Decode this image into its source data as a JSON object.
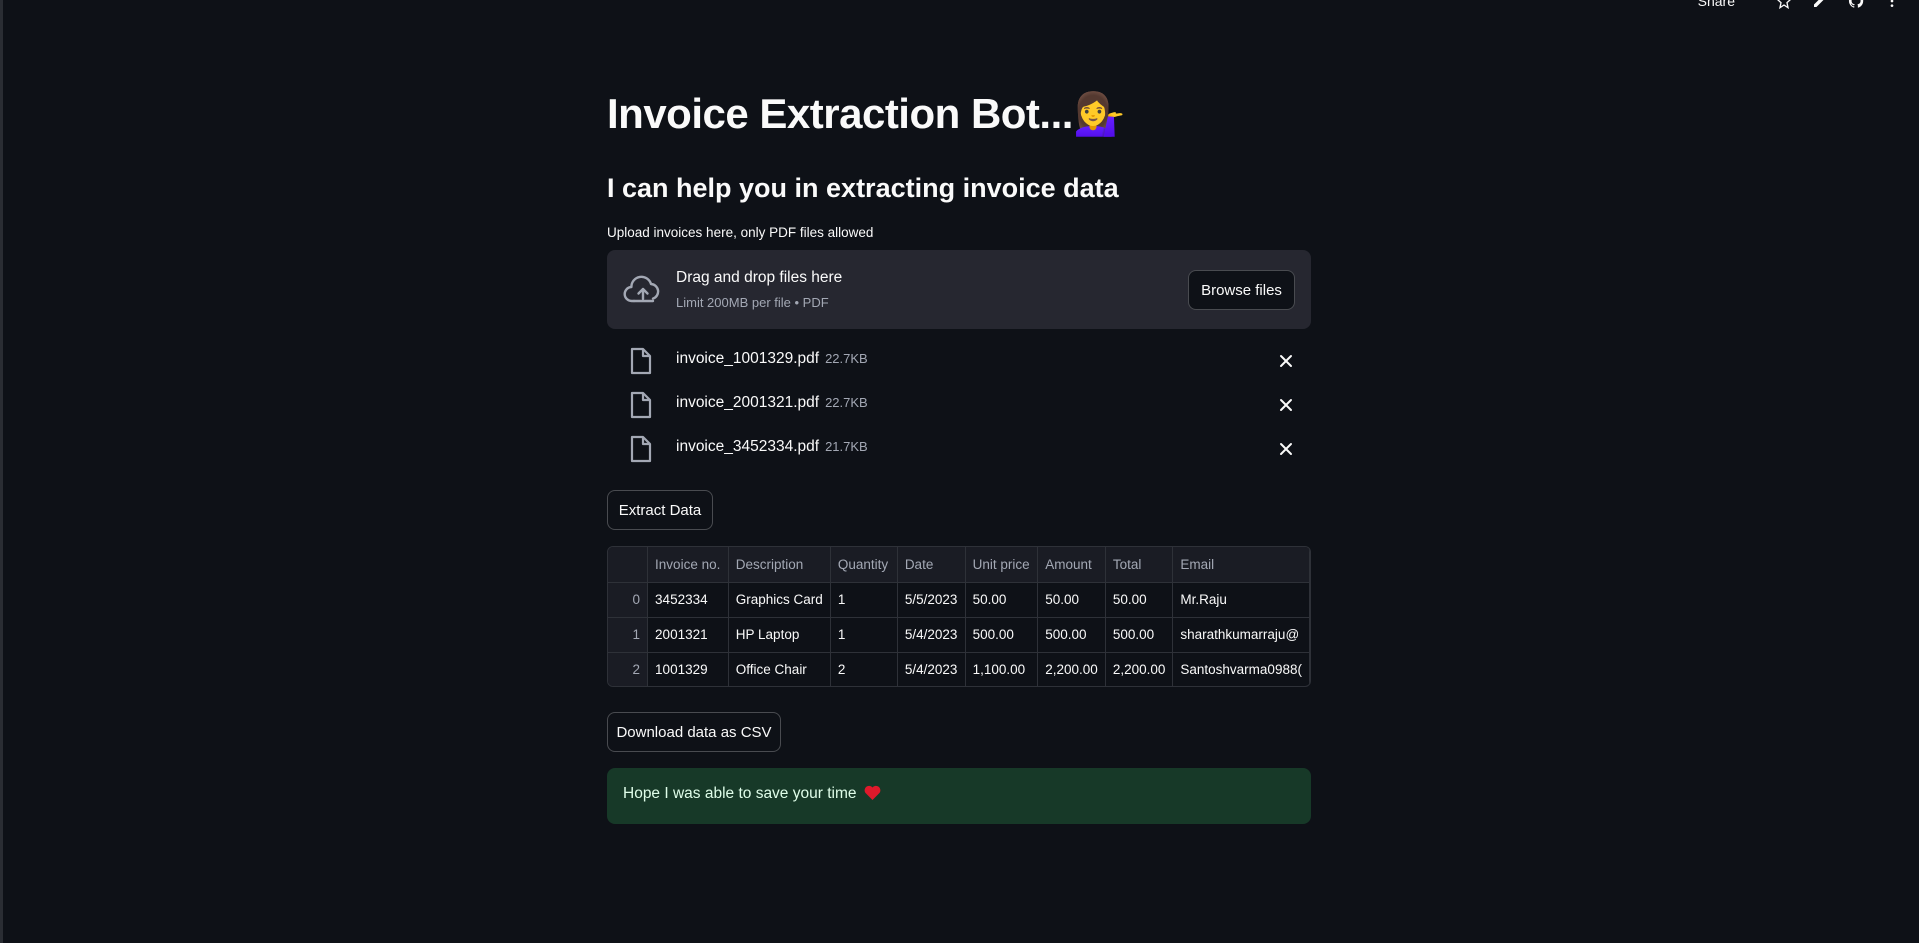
{
  "topbar": {
    "share_label": "Share",
    "icons": [
      "star-icon",
      "pencil-icon",
      "github-icon",
      "more-vertical-icon"
    ]
  },
  "header": {
    "title": "Invoice Extraction Bot...",
    "title_emoji": "💁‍♀️",
    "subtitle": "I can help you in extracting invoice data"
  },
  "uploader": {
    "label": "Upload invoices here, only PDF files allowed",
    "drop_title": "Drag and drop files here",
    "limit_text": "Limit 200MB per file • PDF",
    "browse_label": "Browse files",
    "files": [
      {
        "name": "invoice_1001329.pdf",
        "size": "22.7KB"
      },
      {
        "name": "invoice_2001321.pdf",
        "size": "22.7KB"
      },
      {
        "name": "invoice_3452334.pdf",
        "size": "21.7KB"
      }
    ]
  },
  "actions": {
    "extract_label": "Extract Data",
    "download_label": "Download data as CSV"
  },
  "table": {
    "columns": [
      "",
      "Invoice no.",
      "Description",
      "Quantity",
      "Date",
      "Unit price",
      "Amount",
      "Total",
      "Email"
    ],
    "rows": [
      [
        "0",
        "3452334",
        "Graphics Card",
        "1",
        "5/5/2023",
        "50.00",
        "50.00",
        "50.00",
        "Mr.Raju"
      ],
      [
        "1",
        "2001321",
        "HP Laptop",
        "1",
        "5/4/2023",
        "500.00",
        "500.00",
        "500.00",
        "sharathkumarraju@"
      ],
      [
        "2",
        "1001329",
        "Office Chair",
        "2",
        "5/4/2023",
        "1,100.00",
        "2,200.00",
        "2,200.00",
        "Santoshvarma0988("
      ]
    ]
  },
  "success": {
    "message": "Hope I was able to save your time",
    "emoji": "❤️"
  },
  "colors": {
    "background": "#0e1117",
    "dropzone": "#262730",
    "success_bg": "#173928",
    "success_text": "#dffde9",
    "muted_text": "#a3a8b4"
  }
}
